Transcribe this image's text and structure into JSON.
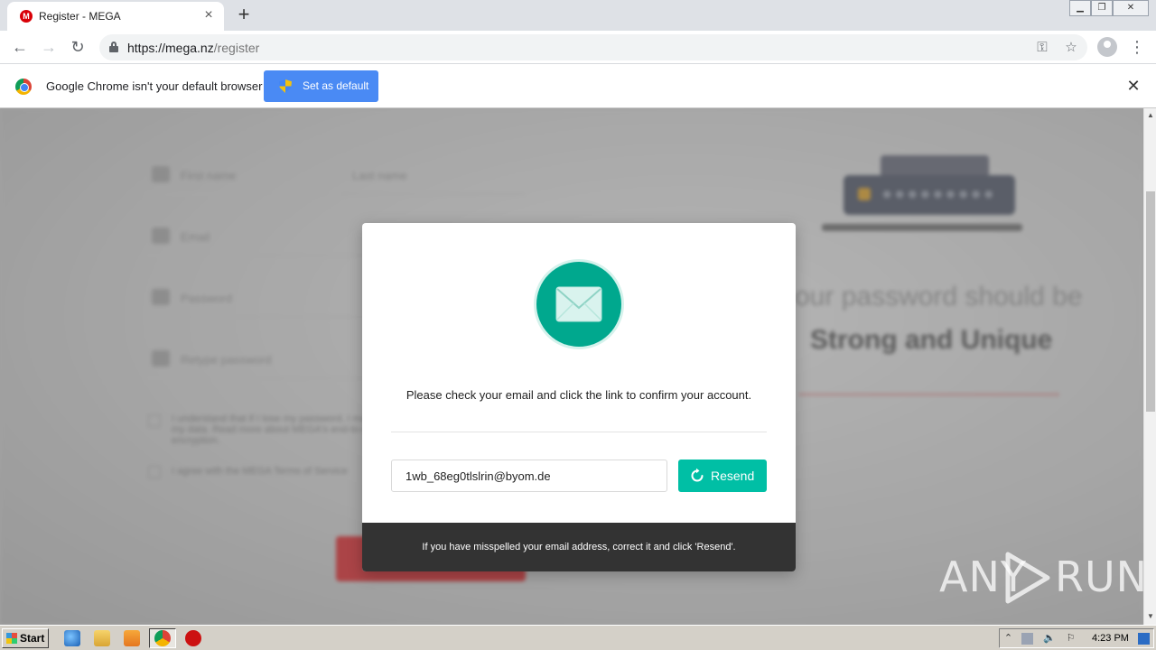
{
  "browser": {
    "tab": {
      "favicon": "M",
      "title": "Register - MEGA",
      "close_icon": "×"
    },
    "new_tab_icon": "+",
    "window_controls": {
      "minimize": "▁",
      "restore": "❐",
      "close": "✕"
    },
    "nav": {
      "back_icon": "←",
      "forward_icon": "→",
      "reload_icon": "↻"
    },
    "url": {
      "scheme_host": "https://mega.nz",
      "path": "/register"
    },
    "key_icon": "⚿",
    "star_icon": "☆",
    "menu_icon": "⋮"
  },
  "infobar": {
    "message": "Google Chrome isn't your default browser",
    "button_label": "Set as default",
    "close_icon": "✕"
  },
  "background_page": {
    "fields": [
      "First name",
      "Last name",
      "Email",
      "Password",
      "Retype password"
    ],
    "check1": "I understand that if I lose my password, I may lose my data. Read more about MEGA's end-to-end encryption.",
    "check2": "I agree with the MEGA Terms of Service",
    "heading1": "our password should be",
    "heading2": "Strong and Unique"
  },
  "modal": {
    "message": "Please check your email and click the link to confirm your account.",
    "email_value": "1wb_68eg0tlslrin@byom.de",
    "resend_label": "Resend",
    "footer": "If you have misspelled your email address, correct it and click 'Resend'."
  },
  "watermark": {
    "left": "ANY",
    "right": "RUN"
  },
  "taskbar": {
    "start_label": "Start",
    "clock": "4:23 PM"
  },
  "colors": {
    "accent_teal": "#00bfa5",
    "mail_circle": "#00a88e",
    "chrome_blue_button": "#4a8af4",
    "mega_red": "#d90007",
    "modal_footer": "#333333"
  }
}
